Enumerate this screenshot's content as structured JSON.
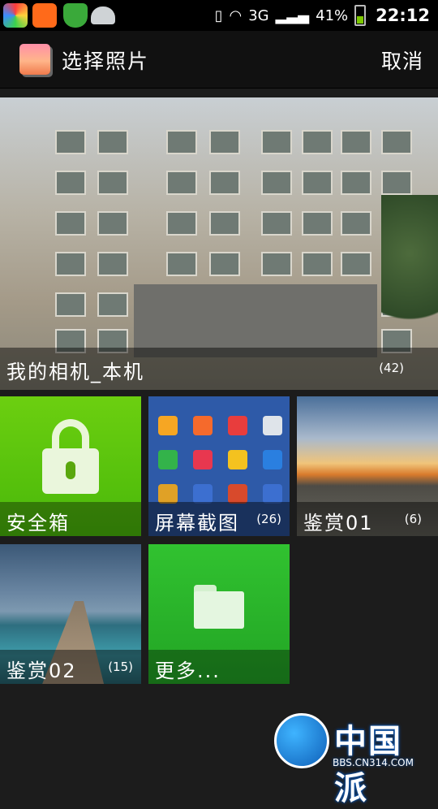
{
  "status_bar": {
    "network": "3G",
    "battery": "41%",
    "time": "22:12",
    "icons": [
      "colorful-launcher-icon",
      "sogou-input-icon",
      "security-icon",
      "android-icon",
      "phone-icon",
      "wifi-icon",
      "signal-icon",
      "battery-icon"
    ]
  },
  "header": {
    "title": "选择照片",
    "cancel_label": "取消"
  },
  "albums": {
    "camera": {
      "name": "我的相机_本机",
      "count": "(42)"
    },
    "safe": {
      "name": "安全箱"
    },
    "screenshots": {
      "name": "屏幕截图",
      "count": "(26)"
    },
    "appreciate01": {
      "name": "鉴赏01",
      "count": "(6)"
    },
    "appreciate02": {
      "name": "鉴赏02",
      "count": "(15)"
    },
    "more": {
      "name": "更多..."
    }
  },
  "watermark": {
    "text": "中国派",
    "url": "BBS.CN314.COM"
  },
  "colors": {
    "safe_tile": "#52bd0c",
    "more_tile": "#28ad28",
    "background": "#1c1c1c"
  }
}
